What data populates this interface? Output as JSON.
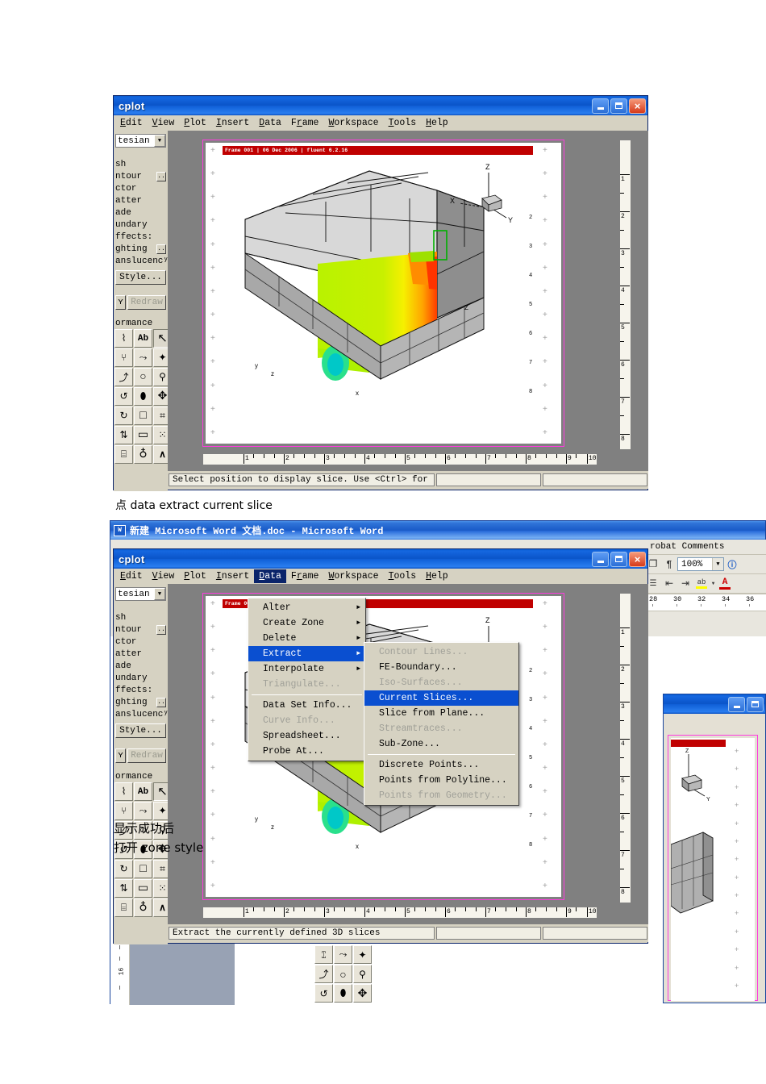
{
  "app": {
    "name": "Tecplot",
    "title_visible": "cplot",
    "menu": [
      {
        "label": "Edit",
        "accel": "E"
      },
      {
        "label": "View",
        "accel": "V"
      },
      {
        "label": "Plot",
        "accel": "P"
      },
      {
        "label": "Insert",
        "accel": "I"
      },
      {
        "label": "Data",
        "accel": "D"
      },
      {
        "label": "Frame",
        "accel": "r"
      },
      {
        "label": "Workspace",
        "accel": "W"
      },
      {
        "label": "Tools",
        "accel": "T"
      },
      {
        "label": "Help",
        "accel": "H"
      }
    ]
  },
  "window_buttons": {
    "minimize": "minimize-button",
    "maximize": "maximize-button",
    "close": "close-button",
    "close_glyph": "×"
  },
  "sidebar": {
    "plot_type_value": "tesian",
    "dropdown_arrow": "▼",
    "layers": [
      {
        "label": "sh",
        "has_detail": false
      },
      {
        "label": "ntour",
        "has_detail": true,
        "detail_glyph": ".."
      },
      {
        "label": "ctor",
        "has_detail": false
      },
      {
        "label": "atter",
        "has_detail": false
      },
      {
        "label": "ade",
        "has_detail": false
      },
      {
        "label": "undary",
        "has_detail": false
      }
    ],
    "effects_header": "ffects:",
    "effects": [
      {
        "label": "ghtinɡ",
        "has_detail": true,
        "detail_glyph": ".."
      },
      {
        "label": "anslucencʸ",
        "has_detail": false
      }
    ],
    "style_button": "Style...",
    "redraw_button": "Redraw",
    "redraw_small": "ʏ",
    "performance_header": "ormance",
    "toolbar_rows": [
      [
        {
          "icon": "brush-icon",
          "glyph": "⌇"
        },
        {
          "icon": "text-tool-icon",
          "glyph": "Ab"
        },
        {
          "icon": "select-arrow-icon",
          "glyph": "↖"
        }
      ],
      [
        {
          "icon": "magnet-icon",
          "glyph": "⑂"
        },
        {
          "icon": "polyline-icon",
          "glyph": "⤳"
        },
        {
          "icon": "wand-icon",
          "glyph": "✦"
        }
      ],
      [
        {
          "icon": "arc-icon",
          "glyph": "⤴"
        },
        {
          "icon": "circle-icon",
          "glyph": "○"
        },
        {
          "icon": "zoom-icon",
          "glyph": "⚲"
        }
      ],
      [
        {
          "icon": "rotate-icon",
          "glyph": "↺"
        },
        {
          "icon": "ellipse-icon",
          "glyph": "⬮"
        },
        {
          "icon": "move-icon",
          "glyph": "✥"
        }
      ],
      [
        {
          "icon": "spin-icon",
          "glyph": "↻"
        },
        {
          "icon": "square-icon",
          "glyph": "□"
        },
        {
          "icon": "probe-icon",
          "glyph": "⌗"
        }
      ],
      [
        {
          "icon": "translate-icon",
          "glyph": "⇅"
        },
        {
          "icon": "rectangle-icon",
          "glyph": "▭"
        },
        {
          "icon": "scatter-icon",
          "glyph": "⁙"
        }
      ],
      [
        {
          "icon": "slider-icon",
          "glyph": "⌸"
        },
        {
          "icon": "globe-icon",
          "glyph": "♁"
        },
        {
          "icon": "streamline-icon",
          "glyph": "∧"
        }
      ]
    ]
  },
  "plot": {
    "frame_banner": "Frame 001 | 06 Dec 2006 | fluent 6.2.16",
    "axis_labels": {
      "z": "Z",
      "x": "X",
      "y": "Y"
    },
    "axis_triad_small": {
      "z": "Z",
      "y": "Y"
    },
    "ruler_h_numbers": [
      "1",
      "2",
      "3",
      "4",
      "5",
      "6",
      "7",
      "8",
      "9",
      "10"
    ],
    "ruler_v_numbers": [
      "1",
      "2",
      "3",
      "4",
      "5",
      "6",
      "7",
      "8"
    ],
    "plus_marker": "+"
  },
  "window1": {
    "status_text": "Select position to display slice.  Use <Ctrl> for near"
  },
  "window2": {
    "status_text": "Extract the currently defined 3D slices",
    "active_menu": "Data"
  },
  "data_menu": {
    "items": [
      {
        "label": "Alter",
        "accel": "A",
        "submenu": true,
        "disabled": false,
        "highlighted": false
      },
      {
        "label": "Create Zone",
        "accel": "C",
        "submenu": true,
        "disabled": false,
        "highlighted": false
      },
      {
        "label": "Delete",
        "accel": "l",
        "submenu": true,
        "disabled": false,
        "highlighted": false
      },
      {
        "label": "Extract",
        "accel": "E",
        "submenu": true,
        "disabled": false,
        "highlighted": true
      },
      {
        "label": "Interpolate",
        "accel": "I",
        "submenu": true,
        "disabled": false,
        "highlighted": false
      },
      {
        "label": "Triangulate...",
        "accel": "T",
        "submenu": false,
        "disabled": true,
        "highlighted": false
      },
      {
        "separator": true
      },
      {
        "label": "Data Set Info...",
        "accel": "D",
        "submenu": false,
        "disabled": false,
        "highlighted": false
      },
      {
        "label": "Curve Info...",
        "accel": "u",
        "submenu": false,
        "disabled": true,
        "highlighted": false
      },
      {
        "label": "Spreadsheet...",
        "accel": "S",
        "submenu": false,
        "disabled": false,
        "highlighted": false
      },
      {
        "label": "Probe At...",
        "accel": "P",
        "submenu": false,
        "disabled": false,
        "highlighted": false
      }
    ]
  },
  "extract_submenu": {
    "items": [
      {
        "label": "Contour Lines...",
        "disabled": true,
        "highlighted": false
      },
      {
        "label": "FE-Boundary...",
        "disabled": false,
        "highlighted": false
      },
      {
        "label": "Iso-Surfaces...",
        "disabled": true,
        "highlighted": false
      },
      {
        "label": "Current Slices...",
        "disabled": false,
        "highlighted": true
      },
      {
        "label": "Slice from Plane...",
        "disabled": false,
        "highlighted": false
      },
      {
        "label": "Streamtraces...",
        "disabled": true,
        "highlighted": false
      },
      {
        "label": "Sub-Zone...",
        "disabled": false,
        "highlighted": false
      },
      {
        "separator": true
      },
      {
        "label": "Discrete Points...",
        "disabled": false,
        "highlighted": false
      },
      {
        "label": "Points from Polyline...",
        "disabled": false,
        "highlighted": false
      },
      {
        "label": "Points from Geometry...",
        "disabled": true,
        "highlighted": false
      }
    ]
  },
  "annotations": {
    "note1": "点 data extract current slice",
    "note2_line1": "显示成功后",
    "note2_line2": "打开 zone style"
  },
  "word": {
    "title": "新建 Microsoft Word 文档.doc - Microsoft Word",
    "doc_icon": "W",
    "acrobat_menu": "robat Comments",
    "zoom_value": "100%",
    "zoom_arrow": "▼",
    "help_icon": "?",
    "toolbar_icons": [
      {
        "name": "print-preview-icon",
        "glyph": "❐"
      },
      {
        "name": "show-formatting-icon",
        "glyph": "¶"
      }
    ],
    "format_icons": [
      {
        "name": "bullet-list-icon",
        "glyph": "☰"
      },
      {
        "name": "decrease-indent-icon",
        "glyph": "⇤"
      },
      {
        "name": "increase-indent-icon",
        "glyph": "⇥"
      },
      {
        "name": "highlight-icon",
        "glyph": "ab"
      },
      {
        "name": "font-color-icon",
        "glyph": "A"
      }
    ],
    "ruler_numbers": [
      "28",
      "30",
      "32",
      "34",
      "36"
    ],
    "vruler_number": "16"
  },
  "colors": {
    "titlebar_blue": "#0a54c8",
    "menu_highlight": "#0a4fd0",
    "chrome_gray": "#d6d2c2",
    "workspace_gray": "#808080",
    "frame_banner_red": "#c00000",
    "paper_border_magenta": "#ff3ce0",
    "contour_green": "#b5f500",
    "contour_yellow": "#ffe800",
    "contour_orange": "#ff9000",
    "contour_red": "#ff3000"
  }
}
